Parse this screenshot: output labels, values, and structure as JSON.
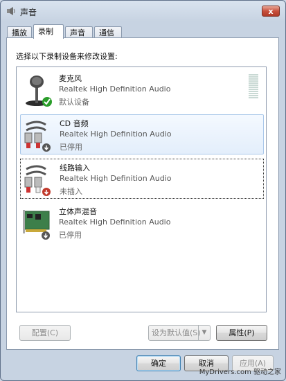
{
  "window": {
    "title": "声音",
    "close_label": "x"
  },
  "tabs": [
    {
      "label": "播放",
      "active": false
    },
    {
      "label": "录制",
      "active": true
    },
    {
      "label": "声音",
      "active": false
    },
    {
      "label": "通信",
      "active": false
    }
  ],
  "instruction": "选择以下录制设备来修改设置:",
  "devices": [
    {
      "name": "麦克风",
      "driver": "Realtek High Definition Audio",
      "status": "默认设备",
      "icon": "microphone-icon",
      "badge": "check"
    },
    {
      "name": "CD 音频",
      "driver": "Realtek High Definition Audio",
      "status": "已停用",
      "icon": "cd-audio-cable-icon",
      "badge": "disabled"
    },
    {
      "name": "线路输入",
      "driver": "Realtek High Definition Audio",
      "status": "未插入",
      "icon": "line-in-cable-icon",
      "badge": "unplugged"
    },
    {
      "name": "立体声混音",
      "driver": "Realtek High Definition Audio",
      "status": "已停用",
      "icon": "sound-card-icon",
      "badge": "disabled"
    }
  ],
  "buttons": {
    "configure": "配置(C)",
    "set_default": "设为默认值(S)",
    "properties": "属性(P)",
    "ok": "确定",
    "cancel": "取消",
    "apply": "应用(A)"
  },
  "watermark": "MyDrivers.com 驱动之家"
}
